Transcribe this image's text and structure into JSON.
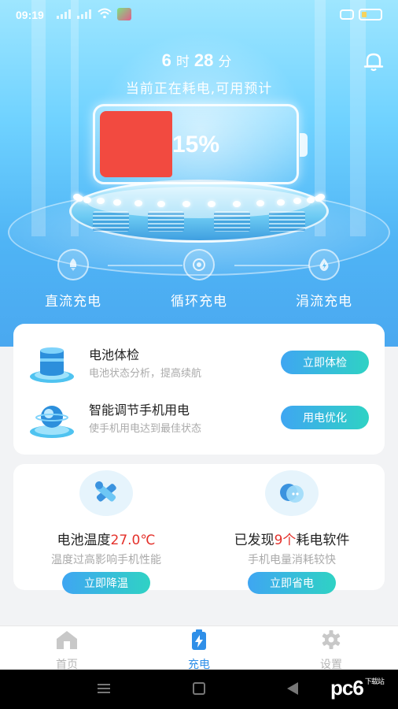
{
  "status_bar": {
    "time": "09:19"
  },
  "hero": {
    "hours": "6",
    "hours_unit": "时",
    "minutes": "28",
    "minutes_unit": "分",
    "subtitle": "当前正在耗电,可用预计",
    "battery_level": 0.15,
    "battery_percent": "15%",
    "battery_color": "#f24a40"
  },
  "modes": [
    {
      "label": "直流充电",
      "icon": "rocket-icon"
    },
    {
      "label": "循环充电",
      "icon": "cycle-icon"
    },
    {
      "label": "涓流充电",
      "icon": "drop-bolt-icon"
    }
  ],
  "features": [
    {
      "title": "电池体检",
      "desc": "电池状态分析，提高续航",
      "button": "立即体检",
      "icon": "battery-checkup-icon"
    },
    {
      "title": "智能调节手机用电",
      "desc": "使手机用电达到最佳状态",
      "button": "用电优化",
      "icon": "smart-adjust-icon"
    }
  ],
  "temperature": {
    "prefix": "电池温度",
    "value": "27.0℃",
    "desc": "温度过高影响手机性能",
    "button": "立即降温",
    "icon": "wrench-icon"
  },
  "apps": {
    "prefix": "已发现",
    "count": "9个",
    "suffix": "耗电软件",
    "desc": "手机电量消耗较快",
    "button": "立即省电",
    "icon": "eco-icon"
  },
  "tabs": [
    {
      "label": "首页",
      "icon": "home-icon",
      "active": false
    },
    {
      "label": "充电",
      "icon": "battery-charging-icon",
      "active": true
    },
    {
      "label": "设置",
      "icon": "gear-icon",
      "active": false
    }
  ],
  "colors": {
    "accent": "#2f8fe8",
    "highlight": "#e4312b",
    "button_start": "#3fa6f2",
    "button_end": "#2fd2c4"
  },
  "watermark": {
    "logo": "pc6",
    "sub": "下载站"
  }
}
